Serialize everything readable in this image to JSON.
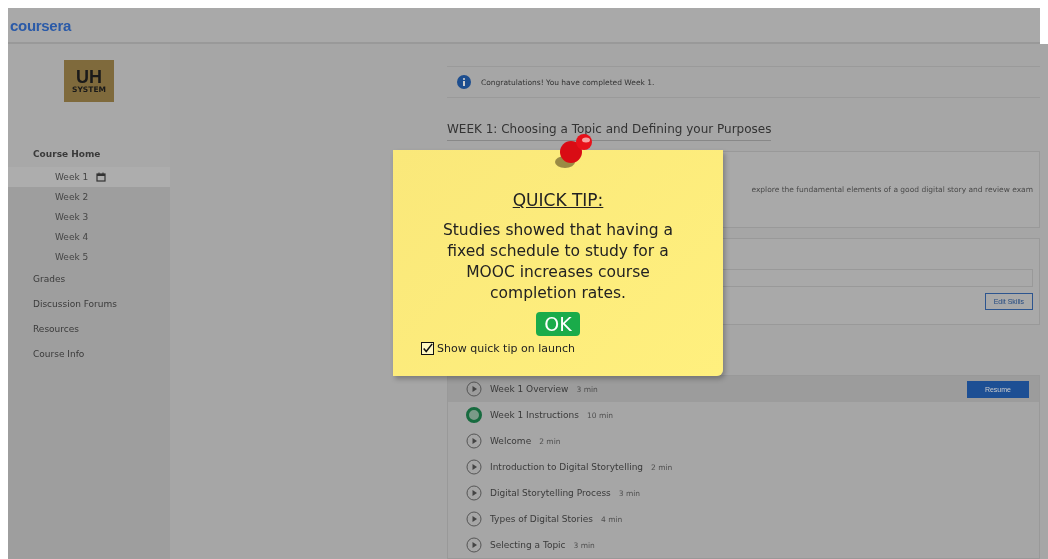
{
  "header": {
    "logo": "coursera"
  },
  "sidebar": {
    "badge": {
      "line1": "UH",
      "line2": "SYSTEM"
    },
    "items": [
      {
        "label": "Course Home",
        "selected": true,
        "children": [
          {
            "label": "Week 1",
            "selected": true,
            "calendar": true
          },
          {
            "label": "Week 2",
            "selected": false,
            "calendar": false
          },
          {
            "label": "Week 3",
            "selected": false,
            "calendar": false
          },
          {
            "label": "Week 4",
            "selected": false,
            "calendar": false
          },
          {
            "label": "Week 5",
            "selected": false,
            "calendar": false
          }
        ]
      },
      {
        "label": "Grades",
        "selected": false
      },
      {
        "label": "Discussion Forums",
        "selected": false
      },
      {
        "label": "Resources",
        "selected": false
      },
      {
        "label": "Course Info",
        "selected": false
      }
    ]
  },
  "notice": "Congratulations! You have completed Week 1.",
  "week_title": "WEEK 1: Choosing a Topic and Defining your Purposes",
  "description": "explore the fundamental elements of a good digital story and review exam",
  "skills": {
    "button": "Edit Skills"
  },
  "lessons": [
    {
      "kind": "video",
      "title": "Week 1 Overview",
      "duration": "3 min",
      "current": true
    },
    {
      "kind": "reading",
      "title": "Week 1 Instructions",
      "duration": "10 min",
      "current": false
    },
    {
      "kind": "video",
      "title": "Welcome",
      "duration": "2 min",
      "current": false
    },
    {
      "kind": "video",
      "title": "Introduction to Digital Storytelling",
      "duration": "2 min",
      "current": false
    },
    {
      "kind": "video",
      "title": "Digital Storytelling Process",
      "duration": "3 min",
      "current": false
    },
    {
      "kind": "video",
      "title": "Types of Digital Stories",
      "duration": "4 min",
      "current": false
    },
    {
      "kind": "video",
      "title": "Selecting a Topic",
      "duration": "3 min",
      "current": false
    }
  ],
  "resume_button": "Resume",
  "tip": {
    "title": "QUICK TIP:",
    "body": "Studies showed that having a fixed schedule to study for a MOOC increases course completion rates.",
    "ok": "OK",
    "checkbox_label": "Show quick tip on launch",
    "checked": true
  }
}
